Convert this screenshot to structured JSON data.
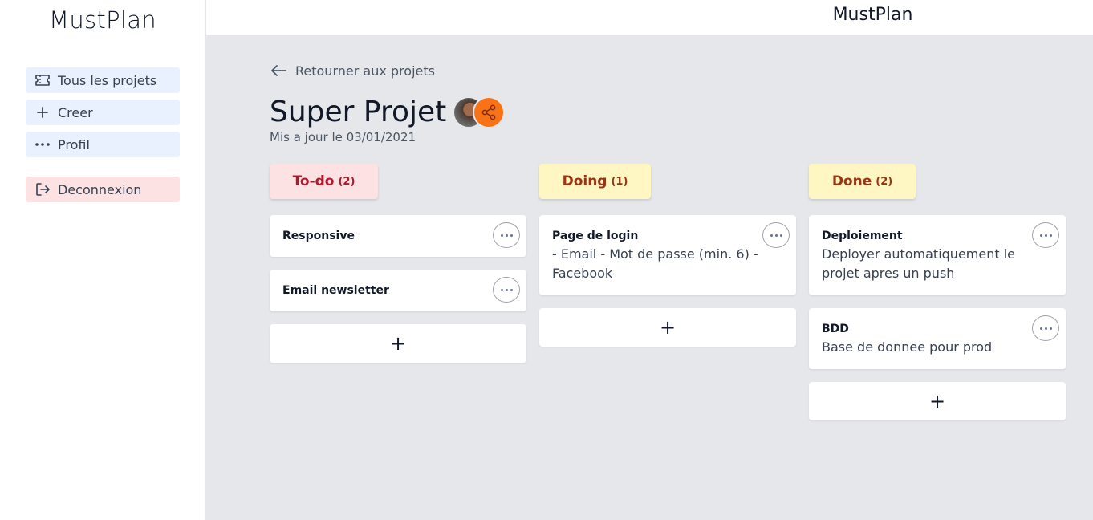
{
  "app": {
    "brand": "MustPlan",
    "top_title": "MustPlan"
  },
  "sidebar": {
    "items": [
      {
        "label": "Tous les projets",
        "icon": "ticket-icon"
      },
      {
        "label": "Creer",
        "icon": "plus-icon"
      },
      {
        "label": "Profil",
        "icon": "dots-icon"
      }
    ],
    "logout": {
      "label": "Deconnexion",
      "icon": "logout-icon"
    }
  },
  "main": {
    "back_label": "Retourner aux projets",
    "project_title": "Super Projet",
    "updated": "Mis a jour le 03/01/2021",
    "accent_color": "#f97316"
  },
  "columns": [
    {
      "name": "To-do",
      "count": "(2)",
      "color": "#b0182b",
      "bg": "#fde2e4",
      "cards": [
        {
          "title": "Responsive",
          "desc": ""
        },
        {
          "title": "Email newsletter",
          "desc": ""
        }
      ],
      "add_label": "+"
    },
    {
      "name": "Doing",
      "count": "(1)",
      "color": "#9a3412",
      "bg": "#fef6c3",
      "cards": [
        {
          "title": "Page de login",
          "desc": "- Email - Mot de passe (min. 6) - Facebook"
        }
      ],
      "add_label": "+"
    },
    {
      "name": "Done",
      "count": "(2)",
      "color": "#9a3412",
      "bg": "#fef6c3",
      "cards": [
        {
          "title": "Deploiement",
          "desc": "Deployer automatiquement le projet apres un push"
        },
        {
          "title": "BDD",
          "desc": "Base de donnee pour prod"
        }
      ],
      "add_label": "+"
    }
  ]
}
